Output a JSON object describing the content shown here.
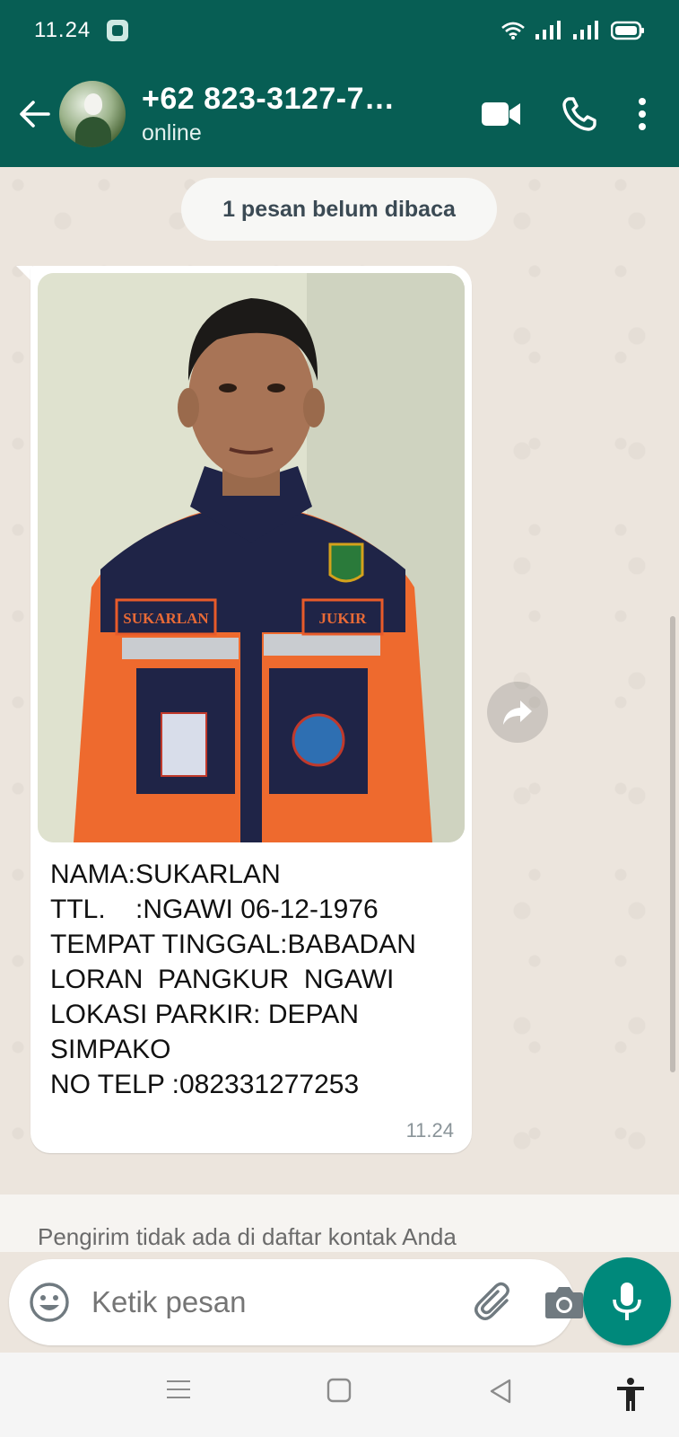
{
  "status_bar": {
    "time": "11.24"
  },
  "header": {
    "contact_name": "+62 823-3127-7…",
    "contact_status": "online",
    "icons": [
      "back-arrow-icon",
      "video-call-icon",
      "voice-call-icon",
      "more-options-icon"
    ]
  },
  "chat": {
    "unread_label": "1 pesan belum dibaca",
    "message": {
      "photo_badges": {
        "name_patch": "SUKARLAN",
        "role_patch": "JUKIR"
      },
      "caption": "NAMA:SUKARLAN\nTTL.    :NGAWI 06-12-1976\nTEMPAT TINGGAL:BABADAN LORAN  PANGKUR  NGAWI\nLOKASI PARKIR: DEPAN SIMPAKO\nNO TELP :082331277253",
      "time": "11.24"
    },
    "not_in_contacts_notice": "Pengirim tidak ada di daftar kontak Anda"
  },
  "composer": {
    "placeholder": "Ketik pesan",
    "icons": [
      "emoji-icon",
      "attach-icon",
      "camera-icon",
      "mic-icon"
    ]
  },
  "colors": {
    "header_bg": "#075e54",
    "accent": "#00897b",
    "chat_bg": "#ece5dd",
    "bubble_bg": "#ffffff"
  }
}
